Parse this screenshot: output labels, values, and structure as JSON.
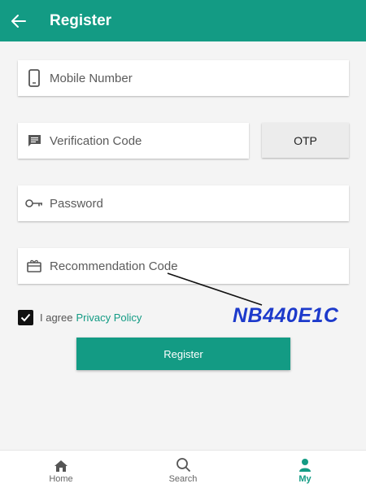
{
  "header": {
    "title": "Register",
    "back_icon": "arrow-left-icon"
  },
  "form": {
    "mobile": {
      "placeholder": "Mobile Number",
      "icon": "phone-icon"
    },
    "verification": {
      "placeholder": "Verification Code",
      "icon": "message-icon"
    },
    "otp_label": "OTP",
    "password": {
      "placeholder": "Password",
      "icon": "key-icon"
    },
    "recommendation": {
      "placeholder": "Recommendation Code",
      "icon": "gift-icon"
    },
    "agree": {
      "checked": true,
      "text": "I agree",
      "link": "Privacy Policy"
    },
    "register_label": "Register"
  },
  "annotation": {
    "code": "NB440E1C"
  },
  "bottom_nav": {
    "items": [
      {
        "label": "Home",
        "icon": "home-icon",
        "active": false
      },
      {
        "label": "Search",
        "icon": "search-icon",
        "active": false
      },
      {
        "label": "My",
        "icon": "person-icon",
        "active": true
      }
    ]
  },
  "colors": {
    "primary": "#139b84",
    "annotation": "#1d3acb"
  }
}
